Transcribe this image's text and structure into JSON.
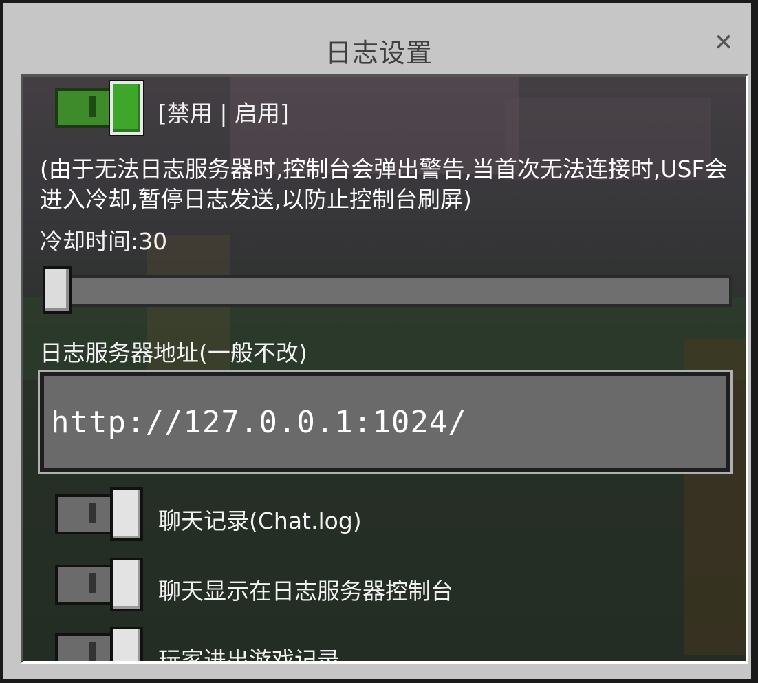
{
  "dialog": {
    "title": "日志设置",
    "close_glyph": "✕"
  },
  "logging_toggle": {
    "label": "[禁用 | 启用]",
    "state": "on"
  },
  "description": "(由于无法日志服务器时,控制台会弹出警告,当首次无法连接时,USF会进入冷却,暂停日志发送,以防止控制台刷屏)",
  "cooldown": {
    "label": "冷却时间:30",
    "value": 30
  },
  "server_address": {
    "label": "日志服务器地址(一般不改)",
    "value": "http://127.0.0.1:1024/"
  },
  "options": [
    {
      "label": "聊天记录(Chat.log)",
      "state": "off"
    },
    {
      "label": "聊天显示在日志服务器控制台",
      "state": "off"
    },
    {
      "label": "玩家进出游戏记录",
      "state": "off"
    }
  ],
  "colors": {
    "toggle_on": "#3fa62c",
    "panel_bg": "#c6c6c6"
  }
}
